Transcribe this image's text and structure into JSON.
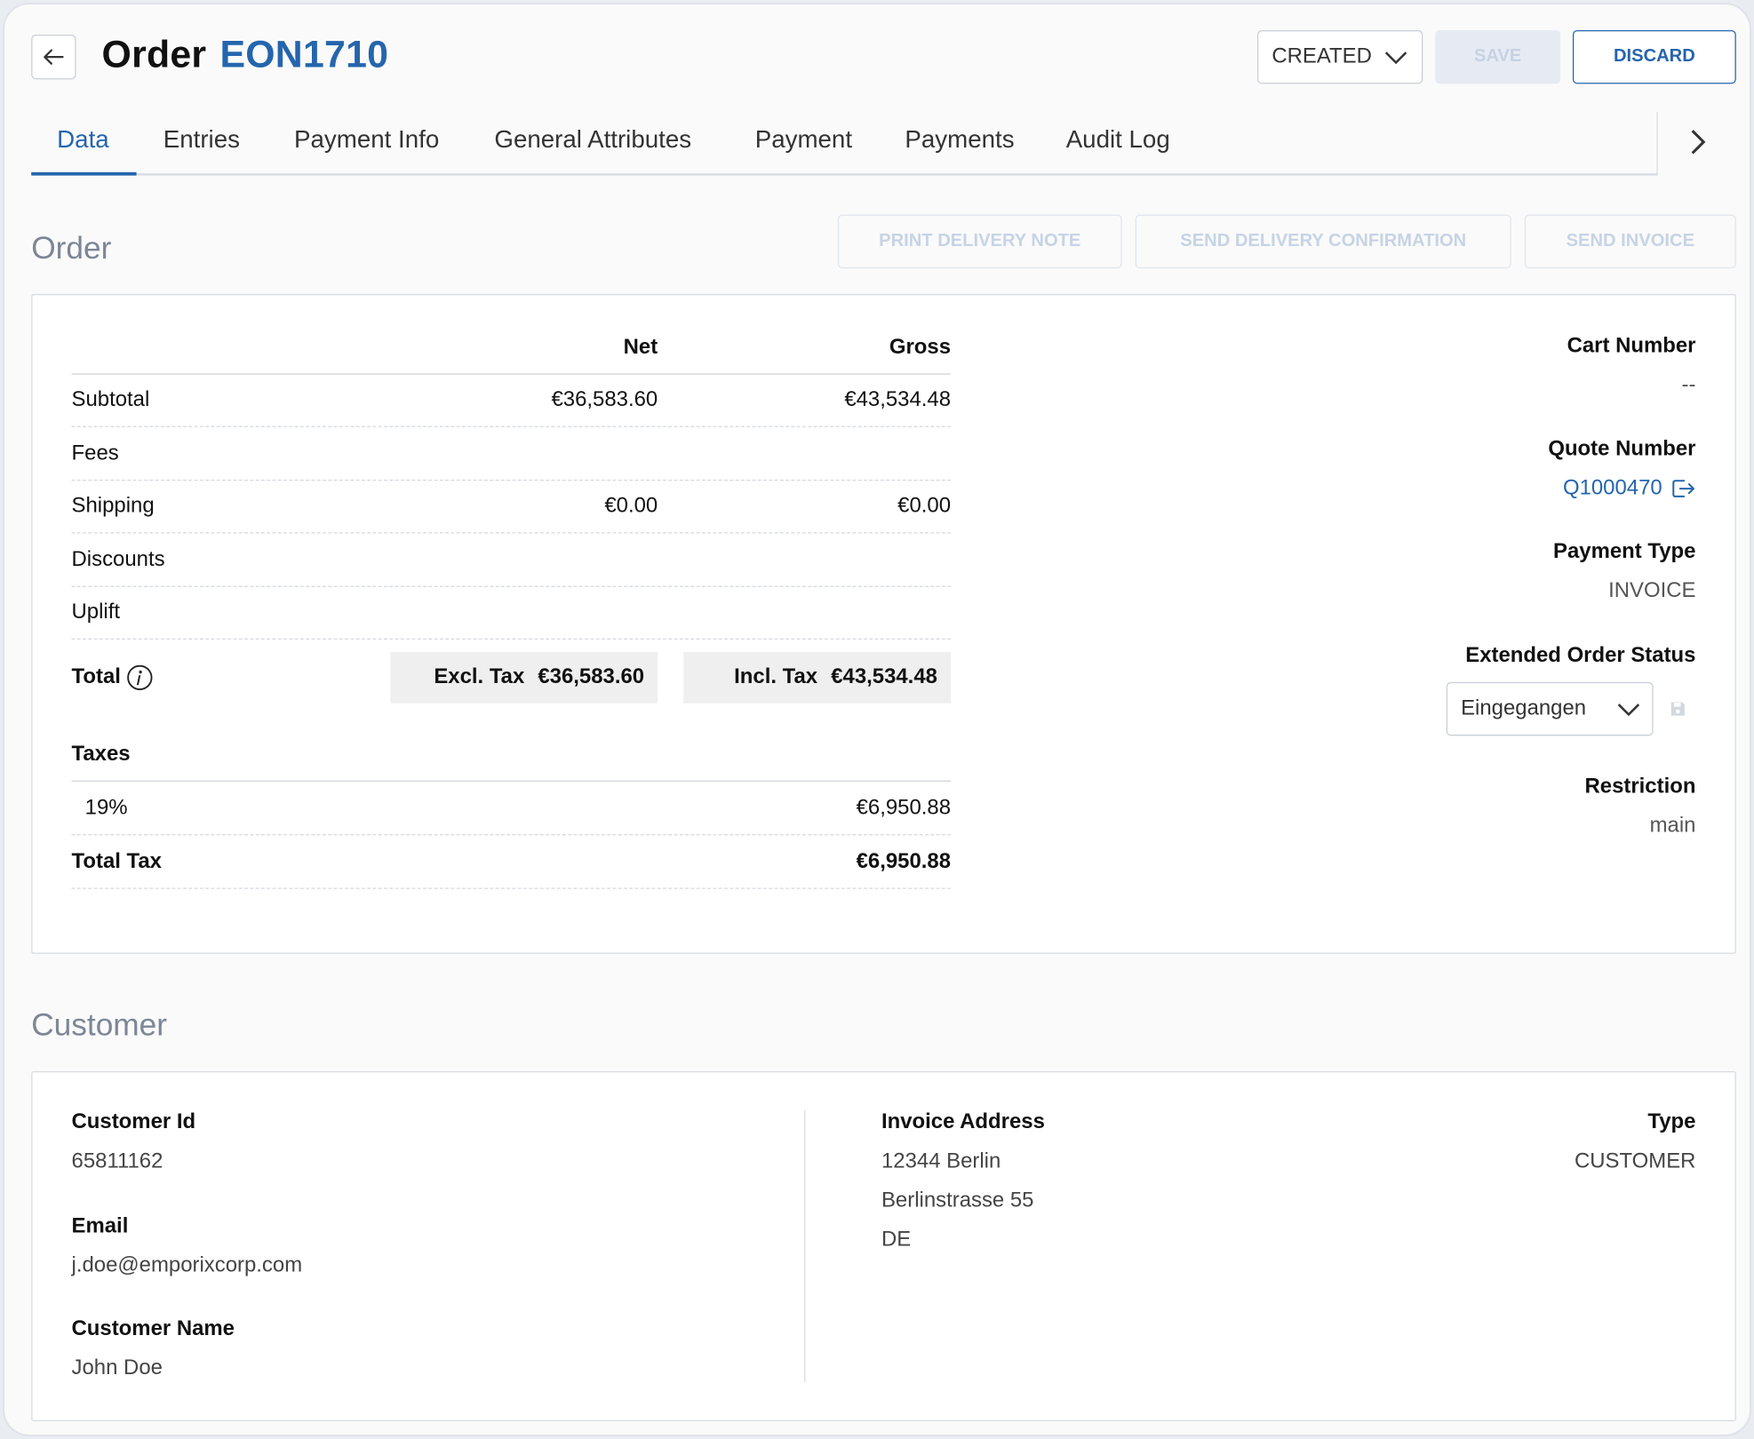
{
  "header": {
    "title_prefix": "Order",
    "order_number": "EON1710",
    "status_value": "CREATED",
    "save_label": "SAVE",
    "discard_label": "DISCARD"
  },
  "tabs": [
    {
      "label": "Data",
      "active": true
    },
    {
      "label": "Entries"
    },
    {
      "label": "Payment Info"
    },
    {
      "label": "General Attributes"
    },
    {
      "label": "Payment"
    },
    {
      "label": "Payments"
    },
    {
      "label": "Audit Log"
    }
  ],
  "order_section": {
    "title": "Order",
    "actions": {
      "print_delivery_note": "PRINT DELIVERY NOTE",
      "send_delivery_confirmation": "SEND DELIVERY CONFIRMATION",
      "send_invoice": "SEND INVOICE"
    },
    "totals": {
      "col_net": "Net",
      "col_gross": "Gross",
      "rows": [
        {
          "label": "Subtotal",
          "net": "€36,583.60",
          "gross": "€43,534.48"
        },
        {
          "label": "Fees",
          "net": "",
          "gross": ""
        },
        {
          "label": "Shipping",
          "net": "€0.00",
          "gross": "€0.00"
        },
        {
          "label": "Discounts",
          "net": "",
          "gross": ""
        },
        {
          "label": "Uplift",
          "net": "",
          "gross": ""
        }
      ],
      "total_label": "Total",
      "excl_label": "Excl. Tax",
      "excl_value": "€36,583.60",
      "incl_label": "Incl. Tax",
      "incl_value": "€43,534.48",
      "taxes_label": "Taxes",
      "tax_rate": "19%",
      "tax_amount": "€6,950.88",
      "total_tax_label": "Total Tax",
      "total_tax_value": "€6,950.88"
    },
    "meta": {
      "cart_number_label": "Cart Number",
      "cart_number_value": "--",
      "quote_number_label": "Quote Number",
      "quote_number_value": "Q1000470",
      "payment_type_label": "Payment Type",
      "payment_type_value": "INVOICE",
      "ext_status_label": "Extended Order Status",
      "ext_status_value": "Eingegangen",
      "restriction_label": "Restriction",
      "restriction_value": "main"
    }
  },
  "customer_section": {
    "title": "Customer",
    "customer_id_label": "Customer Id",
    "customer_id_value": "65811162",
    "email_label": "Email",
    "email_value": "j.doe@emporixcorp.com",
    "name_label": "Customer Name",
    "name_value": "John Doe",
    "invoice_address_label": "Invoice Address",
    "invoice_address_lines": [
      "12344 Berlin",
      "Berlinstrasse 55",
      "DE"
    ],
    "type_label": "Type",
    "type_value": "CUSTOMER"
  },
  "colors": {
    "accent": "#2565ad",
    "muted_title": "#7c8696",
    "disabled_btn": "#c7d3e5"
  }
}
